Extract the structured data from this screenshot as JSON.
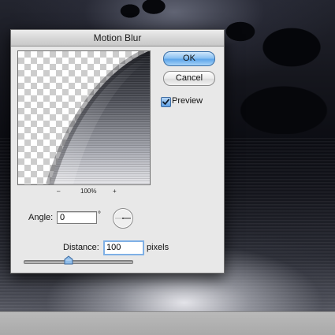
{
  "dialog": {
    "title": "Motion Blur",
    "ok_label": "OK",
    "cancel_label": "Cancel",
    "preview_label": "Preview",
    "preview_checked": true,
    "zoom": {
      "minus_label": "–",
      "level": "100%",
      "plus_label": "+"
    },
    "angle": {
      "label": "Angle:",
      "value": "0",
      "unit": "°"
    },
    "distance": {
      "label": "Distance:",
      "value": "100",
      "unit": "pixels",
      "slider_fraction": 0.41
    }
  },
  "colors": {
    "ok_button": "#6aaeec",
    "dialog_bg": "#e8e8e8",
    "focus_ring": "#7fb0e6"
  },
  "icons": {
    "checkbox": "checkmark-icon",
    "angle_dial": "angle-dial-icon",
    "slider_thumb": "slider-thumb-icon"
  }
}
